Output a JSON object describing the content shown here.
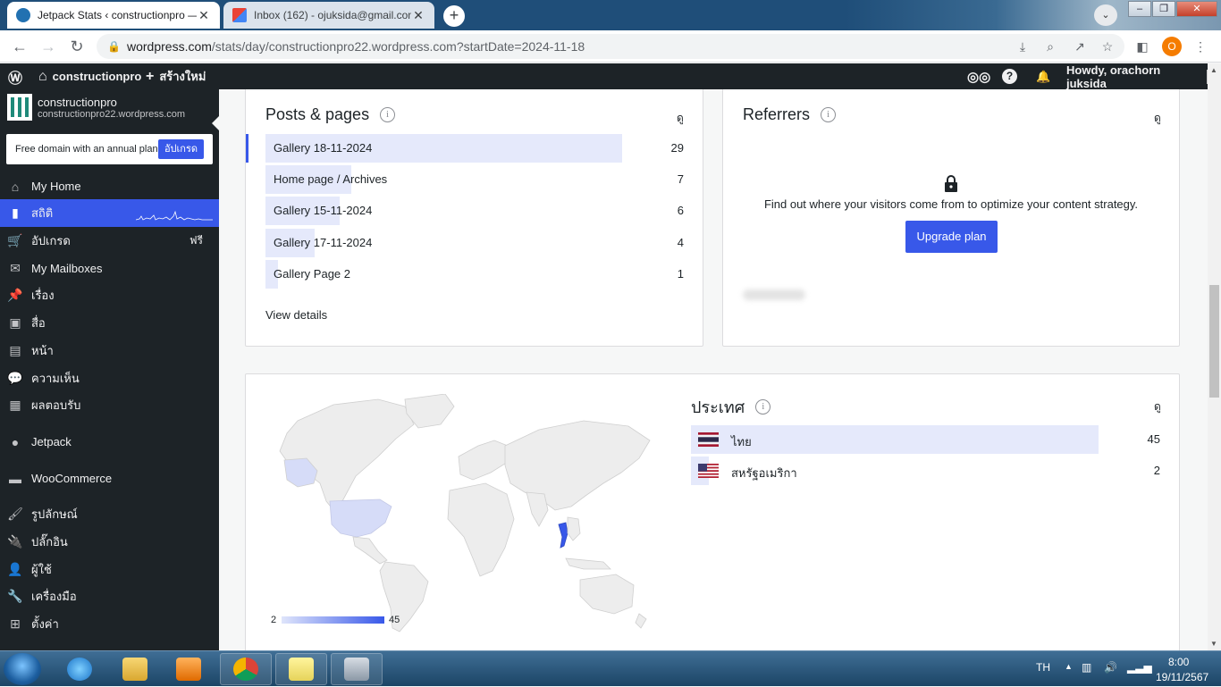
{
  "browser": {
    "tabs": [
      {
        "title": "Jetpack Stats ‹ constructionpro —",
        "active": true
      },
      {
        "title": "Inbox (162) - ojuksida@gmail.com",
        "active": false
      }
    ],
    "new_tab": "+",
    "url_host": "wordpress.com",
    "url_path": "/stats/day/constructionpro22.wordpress.com?startDate=2024-11-18",
    "profile_initial": "O"
  },
  "adminbar": {
    "site": "constructionpro",
    "new": "สร้างใหม่",
    "howdy": "Howdy, orachorn juksida"
  },
  "sidebar": {
    "site_name": "constructionpro",
    "site_url": "constructionpro22.wordpress.com",
    "promo_text": "Free domain with an annual plan",
    "promo_button": "อัปเกรด",
    "items": [
      {
        "label": "My Home",
        "icon": "home-icon"
      },
      {
        "label": "สถิติ",
        "icon": "stats-icon"
      },
      {
        "label": "อัปเกรด",
        "icon": "cart-icon",
        "badge": "ฟรี"
      },
      {
        "label": "My Mailboxes",
        "icon": "mail-icon"
      },
      {
        "label": "เรื่อง",
        "icon": "pin-icon"
      },
      {
        "label": "สื่อ",
        "icon": "media-icon"
      },
      {
        "label": "หน้า",
        "icon": "page-icon"
      },
      {
        "label": "ความเห็น",
        "icon": "comment-icon"
      },
      {
        "label": "ผลตอบรับ",
        "icon": "feedback-icon"
      },
      {
        "label": "Jetpack",
        "icon": "jetpack-icon"
      },
      {
        "label": "WooCommerce",
        "icon": "woo-icon"
      },
      {
        "label": "รูปลักษณ์",
        "icon": "brush-icon"
      },
      {
        "label": "ปลั๊กอิน",
        "icon": "plugin-icon"
      },
      {
        "label": "ผู้ใช้",
        "icon": "user-icon"
      },
      {
        "label": "เครื่องมือ",
        "icon": "wrench-icon"
      },
      {
        "label": "ตั้งค่า",
        "icon": "settings-icon"
      }
    ]
  },
  "posts": {
    "title": "Posts & pages",
    "col": "ดู",
    "rows": [
      {
        "label": "Gallery 18-11-2024",
        "value": 29
      },
      {
        "label": "Home page / Archives",
        "value": 7
      },
      {
        "label": "Gallery 15-11-2024",
        "value": 6
      },
      {
        "label": "Gallery 17-11-2024",
        "value": 4
      },
      {
        "label": "Gallery Page 2",
        "value": 1
      }
    ],
    "view_details": "View details"
  },
  "referrers": {
    "title": "Referrers",
    "col": "ดู",
    "message": "Find out where your visitors come from to optimize your content strategy.",
    "button": "Upgrade plan"
  },
  "countries": {
    "title": "ประเทศ",
    "col": "ดู",
    "rows": [
      {
        "label": "ไทย",
        "value": 45,
        "flag": "thailand-flag"
      },
      {
        "label": "สหรัฐอเมริกา",
        "value": 2,
        "flag": "us-flag"
      }
    ],
    "legend_min": "2",
    "legend_max": "45"
  },
  "taskbar": {
    "lang": "TH",
    "time": "8:00",
    "date": "19/11/2567"
  },
  "colors": {
    "accent": "#3858e9",
    "bar": "#e5e9fb",
    "sidebar": "#1d2327"
  }
}
